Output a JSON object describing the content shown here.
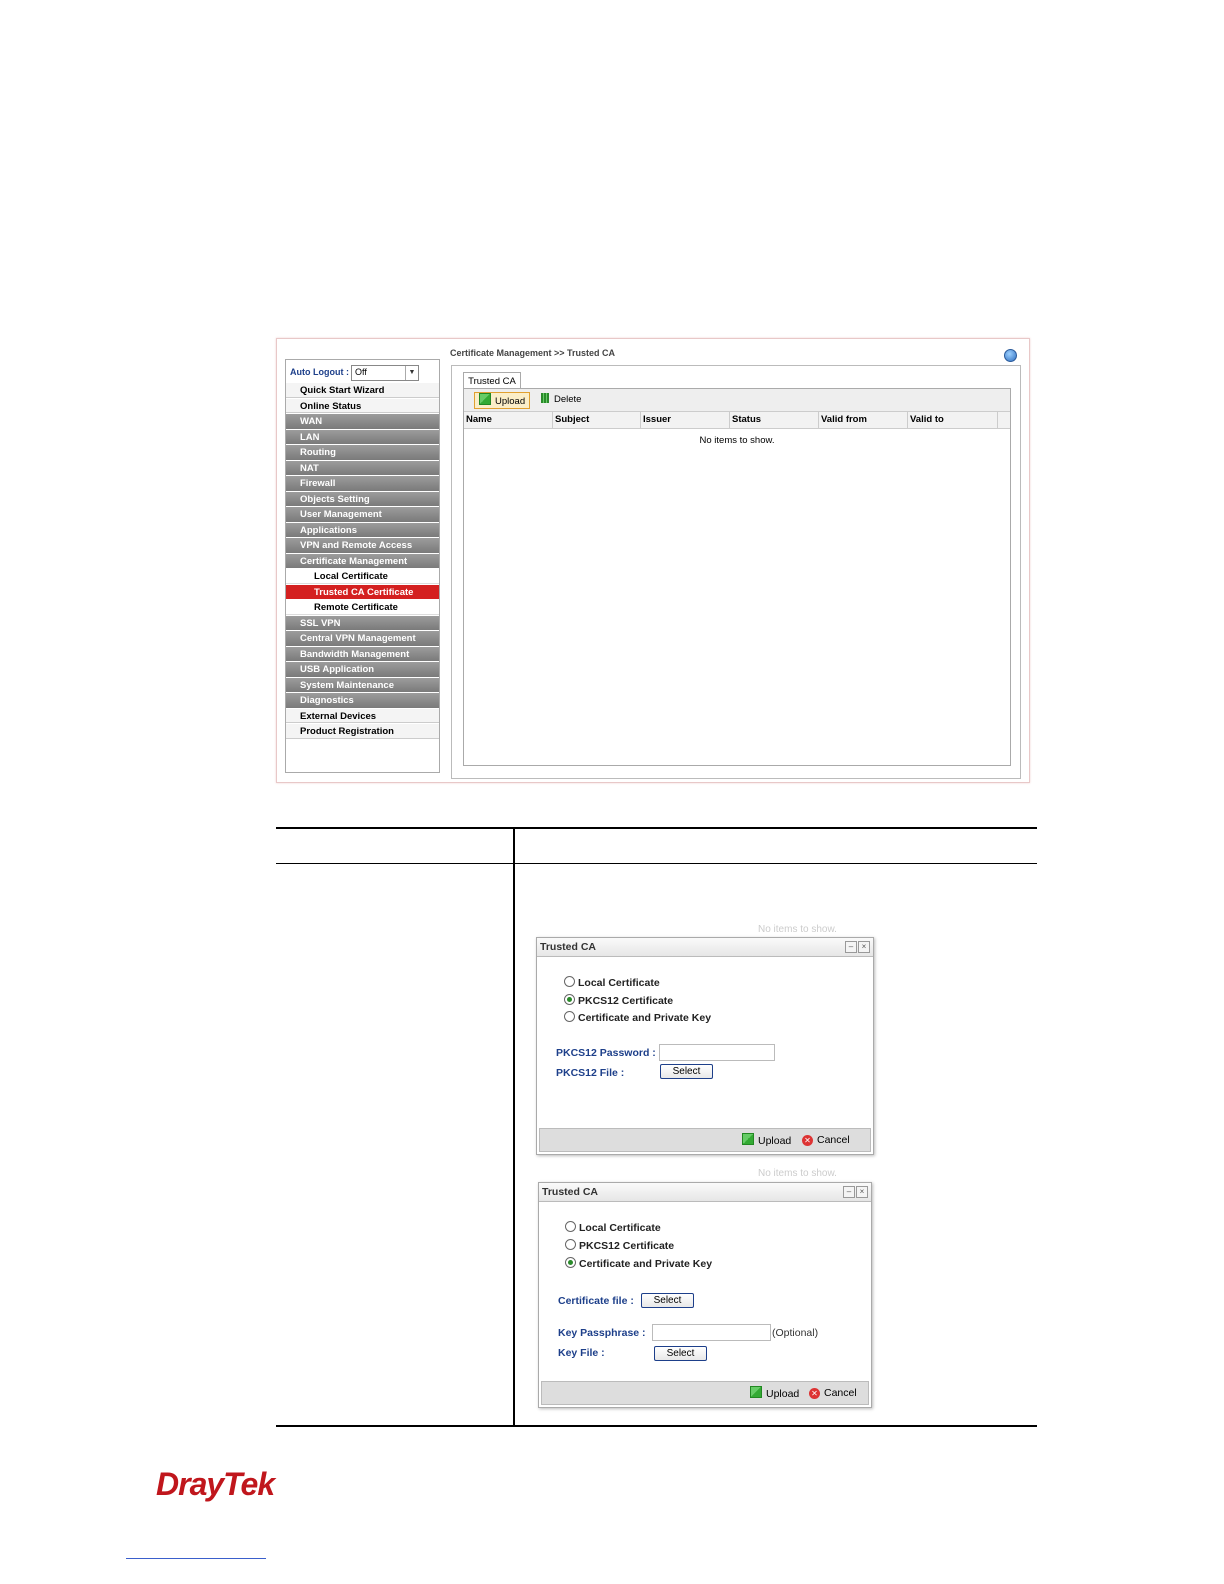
{
  "screenshot": {
    "breadcrumb": "Certificate Management >> Trusted CA",
    "auto_logout": {
      "label": "Auto Logout :",
      "value": "Off"
    },
    "menu": [
      {
        "label": "Quick Start Wizard",
        "style": "w"
      },
      {
        "label": "Online Status",
        "style": "w"
      },
      {
        "label": "WAN",
        "style": "g"
      },
      {
        "label": "LAN",
        "style": "g"
      },
      {
        "label": "Routing",
        "style": "g"
      },
      {
        "label": "NAT",
        "style": "g"
      },
      {
        "label": "Firewall",
        "style": "g"
      },
      {
        "label": "Objects Setting",
        "style": "g"
      },
      {
        "label": "User Management",
        "style": "g"
      },
      {
        "label": "Applications",
        "style": "g"
      },
      {
        "label": "VPN and Remote Access",
        "style": "g"
      },
      {
        "label": "Certificate Management",
        "style": "g"
      },
      {
        "label": "Local Certificate",
        "style": "sub"
      },
      {
        "label": "Trusted CA Certificate",
        "style": "act"
      },
      {
        "label": "Remote Certificate",
        "style": "sub"
      },
      {
        "label": "SSL VPN",
        "style": "g"
      },
      {
        "label": "Central VPN Management",
        "style": "g"
      },
      {
        "label": "Bandwidth Management",
        "style": "g"
      },
      {
        "label": "USB Application",
        "style": "g"
      },
      {
        "label": "System Maintenance",
        "style": "g"
      },
      {
        "label": "Diagnostics",
        "style": "g"
      },
      {
        "label": "External Devices",
        "style": "w"
      },
      {
        "label": "Product Registration",
        "style": "w"
      }
    ],
    "tab": "Trusted CA",
    "toolbar": {
      "upload": "Upload",
      "delete": "Delete"
    },
    "columns": [
      "Name",
      "Subject",
      "Issuer",
      "Status",
      "Valid from",
      "Valid to"
    ],
    "empty_text": "No items to show."
  },
  "dialog1": {
    "ghost": "No items to show.",
    "title": "Trusted CA",
    "options": [
      "Local Certificate",
      "PKCS12 Certificate",
      "Certificate and Private Key"
    ],
    "selected": 1,
    "password_label": "PKCS12 Password :",
    "file_label": "PKCS12 File :",
    "select": "Select",
    "upload": "Upload",
    "cancel": "Cancel"
  },
  "dialog2": {
    "ghost": "No items to show.",
    "title": "Trusted CA",
    "options": [
      "Local Certificate",
      "PKCS12 Certificate",
      "Certificate and Private Key"
    ],
    "selected": 2,
    "cert_label": "Certificate file :",
    "pass_label": "Key Passphrase :",
    "optional": "(Optional)",
    "key_label": "Key File :",
    "select": "Select",
    "upload": "Upload",
    "cancel": "Cancel"
  },
  "logo": {
    "text": "DrayTek",
    "color": "#c0161c"
  },
  "colors": {
    "active_menu": "#d42020",
    "label_blue": "#1d3f8a"
  }
}
